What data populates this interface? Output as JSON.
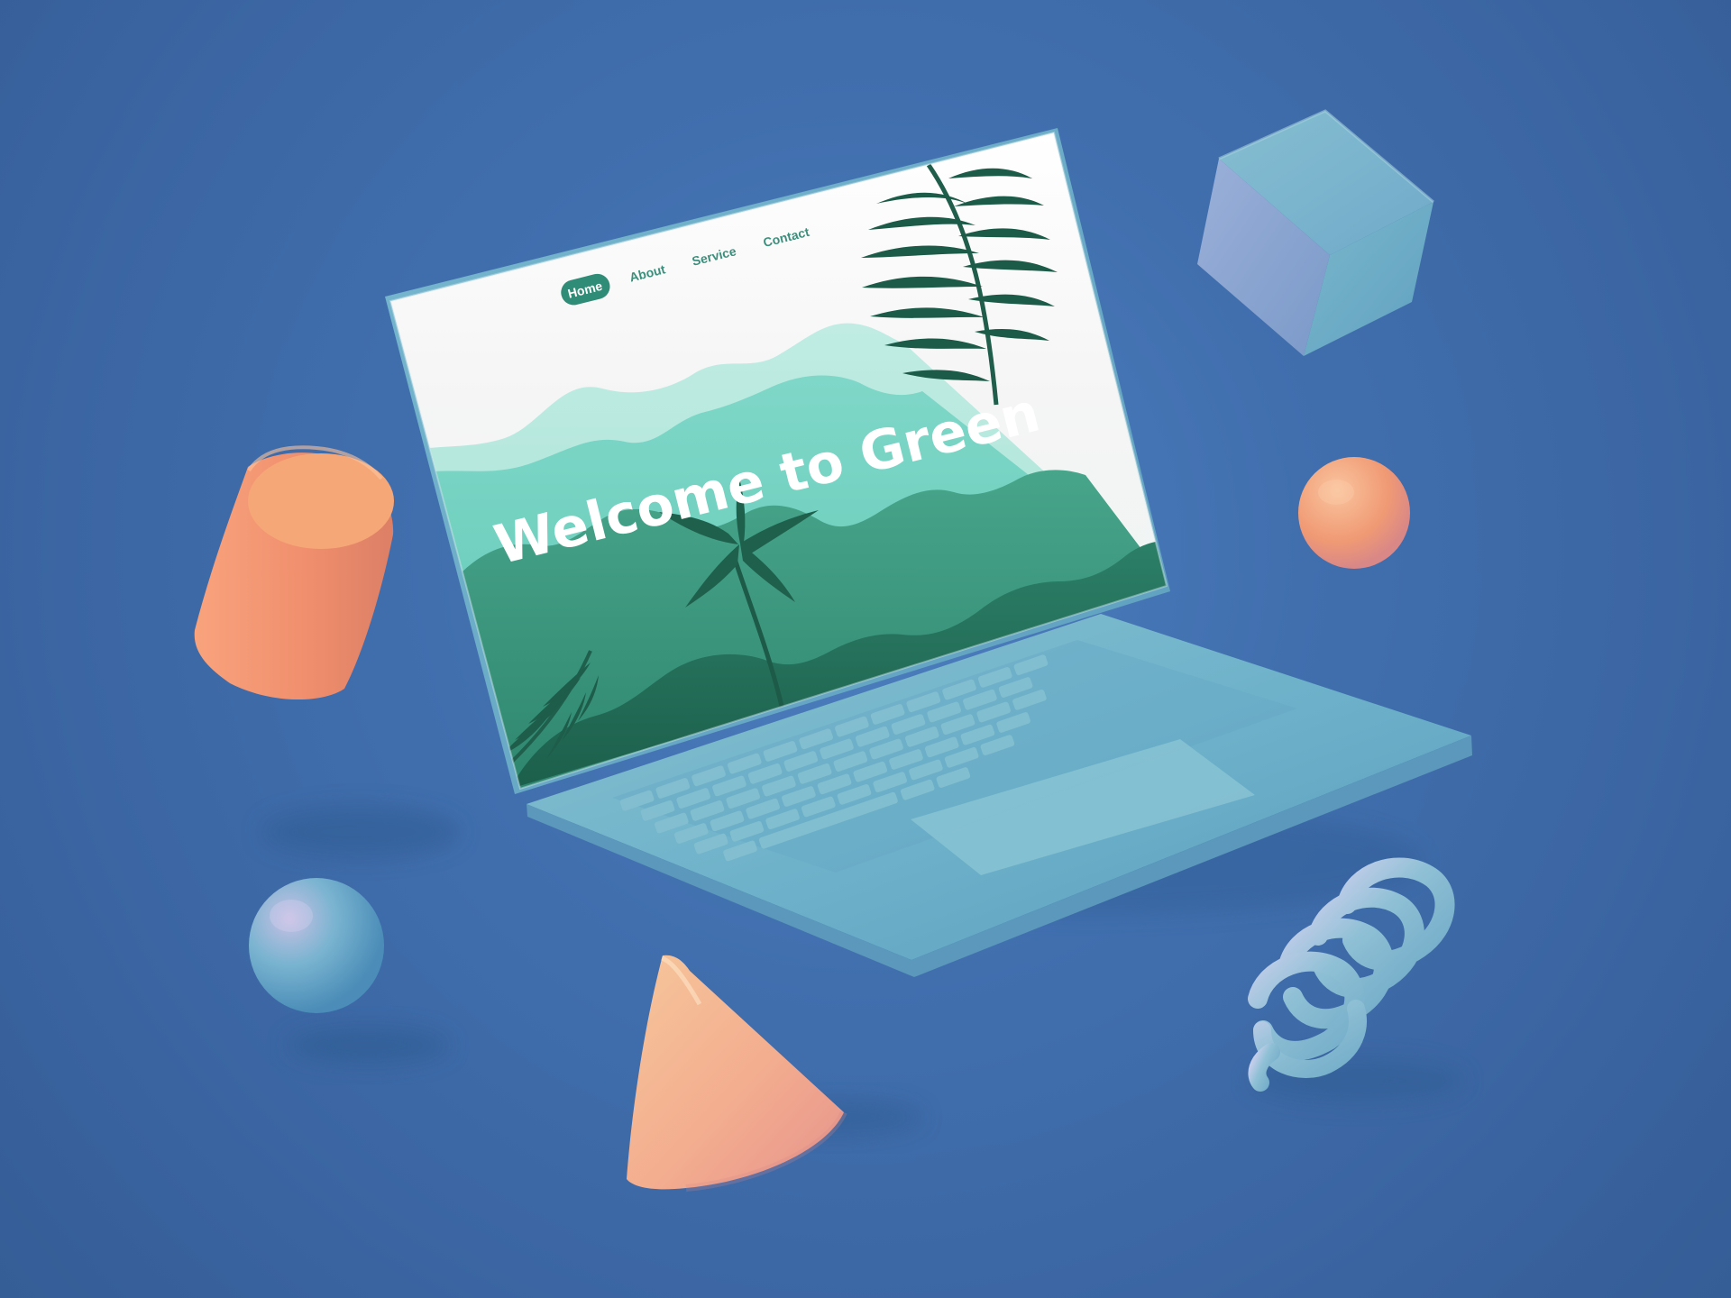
{
  "website": {
    "nav": {
      "items": [
        "Home",
        "About",
        "Service",
        "Contact"
      ],
      "active": "Home"
    },
    "hero": {
      "title": "Welcome to Green"
    },
    "colors": {
      "accent": "#2f8c77",
      "screen_top": "#f8f8f8",
      "mountain_light": "#b7e7dc",
      "mountain_mid": "#6ecfbd",
      "forest": "#2f8f75",
      "forest_dark": "#1f6751"
    }
  },
  "scene": {
    "background_color": "#416fae",
    "device_color": "#6db0c8",
    "objects": [
      "cylinder",
      "cube",
      "sphere",
      "sphere",
      "cone",
      "spring"
    ]
  }
}
